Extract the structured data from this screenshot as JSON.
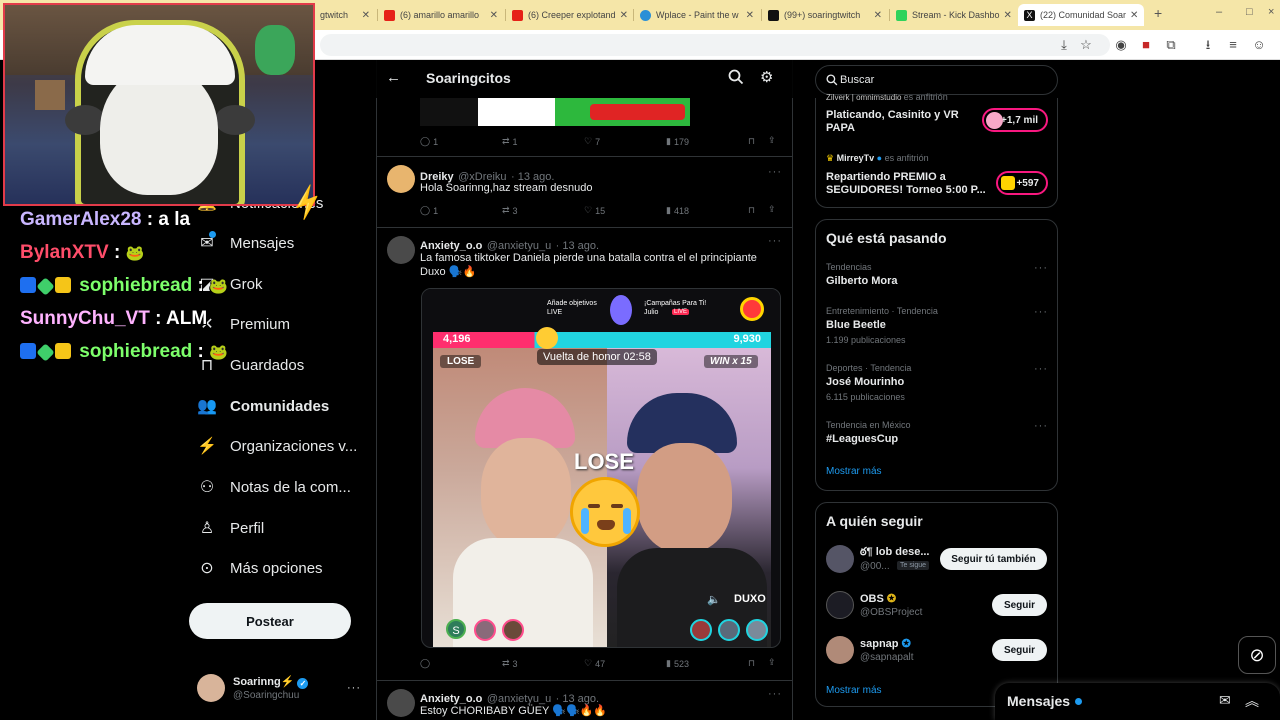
{
  "browser": {
    "tabs": [
      {
        "title": "gtwitch"
      },
      {
        "title": "(6) amarillo amarillo"
      },
      {
        "title": "(6) Creeper explotand"
      },
      {
        "title": "Wplace - Paint the w"
      },
      {
        "title": "(99+) soaringtwitch"
      },
      {
        "title": "Stream - Kick Dashbo"
      },
      {
        "title": "(22) Comunidad Soar"
      }
    ],
    "new_tab": "+",
    "window_controls": [
      "–",
      "□",
      "×"
    ]
  },
  "chat_overlay": [
    {
      "user": "GamerAlex28",
      "msg": ": a la",
      "color": "#c9b6ff"
    },
    {
      "user": "BylanXTV",
      "msg": ":",
      "color": "#ff4d6a"
    },
    {
      "user": "sophiebread",
      "msg": ":",
      "color": "#7dff6b"
    },
    {
      "user": "SunnyChu_VT",
      "msg": ": ALM",
      "color": "#ffb3ff"
    },
    {
      "user": "sophiebread",
      "msg": ":",
      "color": "#7dff6b"
    }
  ],
  "nav": {
    "items": [
      {
        "label": "Notificaciones"
      },
      {
        "label": "Mensajes"
      },
      {
        "label": "Grok"
      },
      {
        "label": "Premium"
      },
      {
        "label": "Guardados"
      },
      {
        "label": "Comunidades"
      },
      {
        "label": "Organizaciones v..."
      },
      {
        "label": "Notas de la com..."
      },
      {
        "label": "Perfil"
      },
      {
        "label": "Más opciones"
      }
    ],
    "post_label": "Postear",
    "account": {
      "name": "Soarinng⚡",
      "handle": "@Soaringchuu"
    }
  },
  "header": {
    "title": "Soaringcitos"
  },
  "tweets": [
    {
      "stats": {
        "replies": "1",
        "retweets": "1",
        "likes": "7",
        "views": "179"
      }
    },
    {
      "name": "Dreiky",
      "handle": "@xDreiku",
      "date": "· 13 ago.",
      "text": "Hola Soarinng,haz stream desnudo",
      "stats": {
        "replies": "1",
        "retweets": "3",
        "likes": "15",
        "views": "418"
      }
    },
    {
      "name": "Anxiety_o.o",
      "handle": "@anxietyu_u",
      "date": "· 13 ago.",
      "text": "La famosa tiktoker Daniela pierde una batalla contra el el principiante Duxo",
      "stats": {
        "replies": "",
        "retweets": "3",
        "likes": "47",
        "views": "523"
      }
    },
    {
      "name": "Anxiety_o.o",
      "handle": "@anxietyu_u",
      "date": "· 13 ago.",
      "text": "Estoy CHORIBABY GÜEY"
    }
  ],
  "video": {
    "promo_left": "Añade objetivos LIVE",
    "promo_right": "¡Campañas Para Ti! Julio",
    "live_tag": "LIVE",
    "score_left": "4,196",
    "score_right": "9,930",
    "timer": "Vuelta de honor 02:58",
    "lose_tag": "LOSE",
    "win_tag": "WIN x 15",
    "lose_big": "LOSE",
    "name": "DUXO",
    "guest_initial": "S"
  },
  "search": {
    "placeholder": "Buscar"
  },
  "spaces": [
    {
      "host": "Zilverk | omnimstudio",
      "role": "es anfitrión",
      "title": "Platicando, Casinito y VR PAPA",
      "count": "+1,7 mil"
    },
    {
      "host": "MirreyTv",
      "role": "es anfitrión",
      "title": "Repartiendo PREMIO a SEGUIDORES! Torneo 5:00 P...",
      "count": "+597"
    }
  ],
  "trending": {
    "title": "Qué está pasando",
    "items": [
      {
        "context": "Tendencias",
        "name": "Gilberto Mora",
        "posts": ""
      },
      {
        "context": "Entretenimiento · Tendencia",
        "name": "Blue Beetle",
        "posts": "1.199 publicaciones"
      },
      {
        "context": "Deportes · Tendencia",
        "name": "José Mourinho",
        "posts": "6.115 publicaciones"
      },
      {
        "context": "Tendencia en México",
        "name": "#LeaguesCup",
        "posts": ""
      }
    ],
    "more": "Mostrar más"
  },
  "who_to_follow": {
    "title": "A quién seguir",
    "items": [
      {
        "name": "ఠ¶ lob dese...",
        "handle": "@00...",
        "tag": "Te sigue",
        "button": "Seguir tú también"
      },
      {
        "name": "OBS",
        "handle": "@OBSProject",
        "tag": "",
        "button": "Seguir"
      },
      {
        "name": "sapnap",
        "handle": "@sapnapalt",
        "tag": "",
        "button": "Seguir"
      }
    ],
    "more": "Mostrar más"
  },
  "messages_bar": {
    "title": "Mensajes"
  },
  "colors": {
    "accent": "#1d9bf0",
    "cam_border": "#e23b4a",
    "background": "#000000"
  }
}
